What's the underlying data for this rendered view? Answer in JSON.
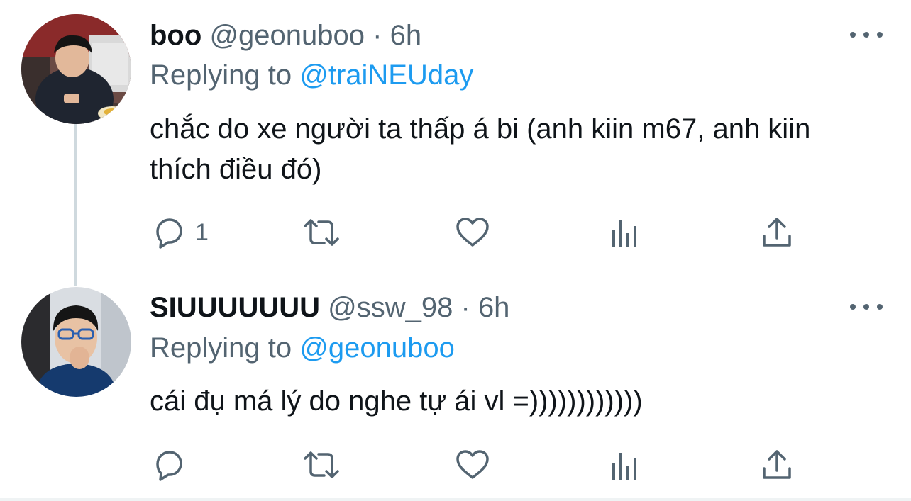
{
  "tweets": [
    {
      "name": "boo",
      "handle": "@geonuboo",
      "separator": "·",
      "time": "6h",
      "replying_prefix": "Replying to",
      "replying_handle": "@traiNEUday",
      "text": "chắc do xe người ta thấp á bi (anh kiin m67, anh kiin thích điều đó)",
      "reply_count": "1",
      "icons": [
        "reply-icon",
        "retweet-icon",
        "like-icon",
        "analytics-icon",
        "share-icon",
        "more-icon"
      ]
    },
    {
      "name": "SIUUUUUUU",
      "handle": "@ssw_98",
      "separator": "·",
      "time": "6h",
      "replying_prefix": "Replying to",
      "replying_handle": "@geonuboo",
      "text": "cái đụ má lý do nghe tự ái vl =))))))))))))",
      "reply_count": "",
      "icons": [
        "reply-icon",
        "retweet-icon",
        "like-icon",
        "analytics-icon",
        "share-icon",
        "more-icon"
      ]
    }
  ],
  "colors": {
    "text": "#0f1419",
    "secondary": "#536471",
    "link": "#1d9bf0",
    "thread_line": "#cfd9de"
  }
}
